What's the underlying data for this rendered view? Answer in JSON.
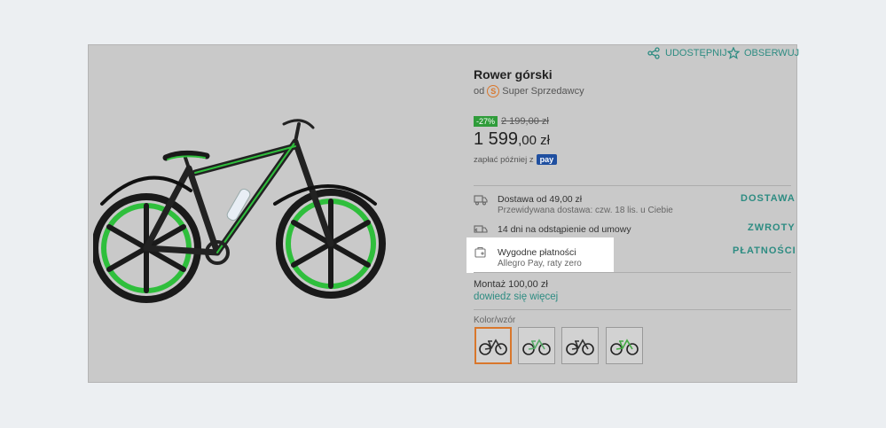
{
  "header": {
    "share_label": "UDOSTĘPNIJ",
    "follow_label": "OBSERWUJ"
  },
  "product": {
    "title": "Rower górski",
    "seller_prefix": "od",
    "seller_badge": "Super Sprzedawcy",
    "discount": "-27%",
    "old_price": "2 199,00 zł",
    "price_main": "1 599",
    "price_cents": ",00 zł",
    "pay_later_text": "zapłać później z",
    "pay_badge": "pay"
  },
  "info": {
    "delivery_title": "Dostawa od 49,00 zł",
    "delivery_sub": "Przewidywana dostawa: czw. 18 lis. u Ciebie",
    "delivery_link": "DOSTAWA",
    "returns_title": "14 dni na odstąpienie od umowy",
    "returns_link": "ZWROTY",
    "payments_title": "Wygodne płatności",
    "payments_sub": "Allegro Pay, raty zero",
    "payments_link": "PŁATNOŚCI"
  },
  "assembly": {
    "text": "Montaż 100,00 zł",
    "link": "dowiedz się więcej"
  },
  "variants": {
    "label": "Kolor/wzór",
    "selected_index": 0,
    "items": [
      "variant-1",
      "variant-2",
      "variant-3",
      "variant-4"
    ]
  },
  "colors": {
    "accent": "#2d8c82",
    "discount_bg": "#2f9c3a",
    "selected_border": "#d9772c",
    "pay_badge": "#1f4fa0"
  },
  "icons": [
    "share-icon",
    "star-icon",
    "truck-icon",
    "return-icon",
    "wallet-icon"
  ]
}
